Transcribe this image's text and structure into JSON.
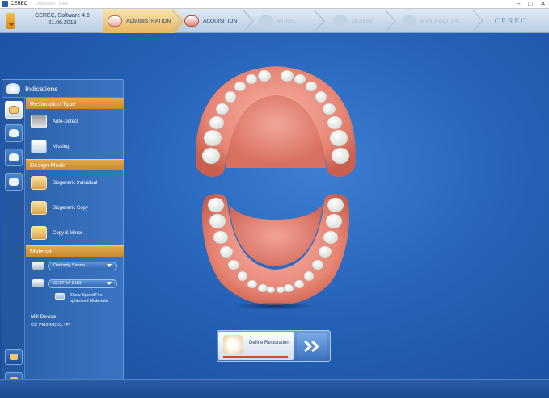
{
  "window": {
    "title": "CEREC",
    "blurred_tab": "Unbenannt · Patie"
  },
  "topbar": {
    "software": "CEREC, Software 4.6",
    "date": "01.06.2018",
    "phases": [
      {
        "label": "ADMINISTRATION",
        "state": "active"
      },
      {
        "label": "ACQUISITION",
        "state": "enabled"
      },
      {
        "label": "MODEL",
        "state": "disabled"
      },
      {
        "label": "DESIGN",
        "state": "disabled"
      },
      {
        "label": "MANUFACTURE",
        "state": "disabled"
      }
    ],
    "brand": "CEREC"
  },
  "panel": {
    "title": "Indications",
    "restoration_type": {
      "header": "Restoration Type",
      "items": [
        "Auto-Detect",
        "Missing"
      ]
    },
    "design_mode": {
      "header": "Design Mode",
      "items": [
        "Biogeneric Individual",
        "Biogeneric Copy",
        "Copy & Mirror"
      ]
    },
    "material": {
      "header": "Material",
      "manufacturer": "Dentsply Sirona",
      "block": "CELTRA DUO",
      "speedfire_label": "Show SpeedFire optimized Materials"
    },
    "mill": {
      "label": "Mill Device",
      "value": "GC-PMZ MC XL PP"
    }
  },
  "actions": {
    "define_label": "Define Restoration"
  },
  "colors": {
    "accent_orange": "#d9a14a",
    "background_blue": "#2562b8",
    "active_underline": "#d24a2a"
  }
}
